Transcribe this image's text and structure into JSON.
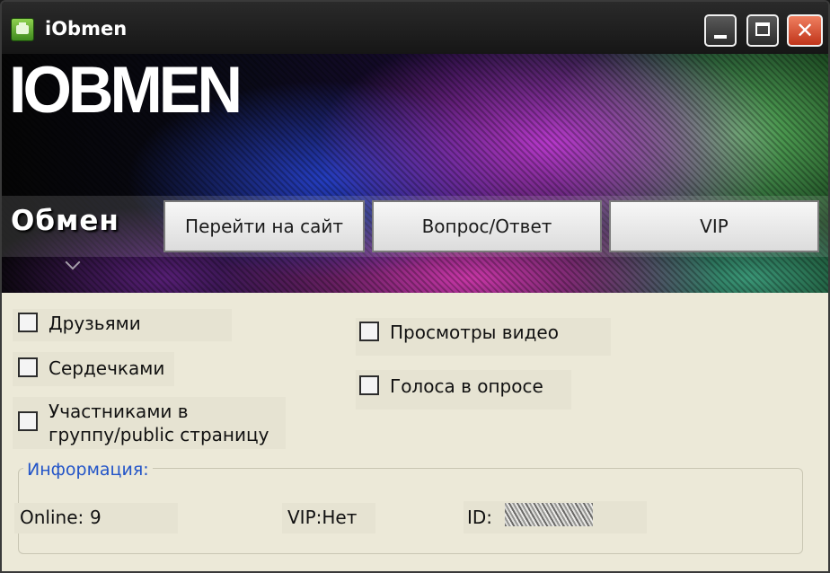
{
  "window": {
    "title": "iObmen",
    "controls": [
      "minimize",
      "maximize",
      "close"
    ],
    "close_glyph": "✕"
  },
  "banner": {
    "logo": "IOBMEN",
    "active_tab": "Обмен",
    "nav_buttons": [
      {
        "label": "Перейти на сайт"
      },
      {
        "label": "Вопрос/Ответ"
      },
      {
        "label": "VIP"
      }
    ]
  },
  "options": {
    "left": [
      {
        "label": "Друзьями",
        "checked": false
      },
      {
        "label": "Сердечками",
        "checked": false
      },
      {
        "label_line1": "Участниками в",
        "label_line2": "группу/public страницу",
        "checked": false
      }
    ],
    "right": [
      {
        "label": "Просмотры видео",
        "checked": false
      },
      {
        "label": "Голоса в опросе",
        "checked": false
      }
    ]
  },
  "info": {
    "title": "Информация:",
    "online_label": "Online:",
    "online_value": "9",
    "vip_text": "VIP:Нет",
    "id_label": "ID:",
    "id_value": "(redacted)"
  },
  "colors": {
    "client_bg": "#ece9d8",
    "group_title": "#2254c8",
    "close_button": "#d9432a",
    "app_icon": "#5cb030"
  }
}
